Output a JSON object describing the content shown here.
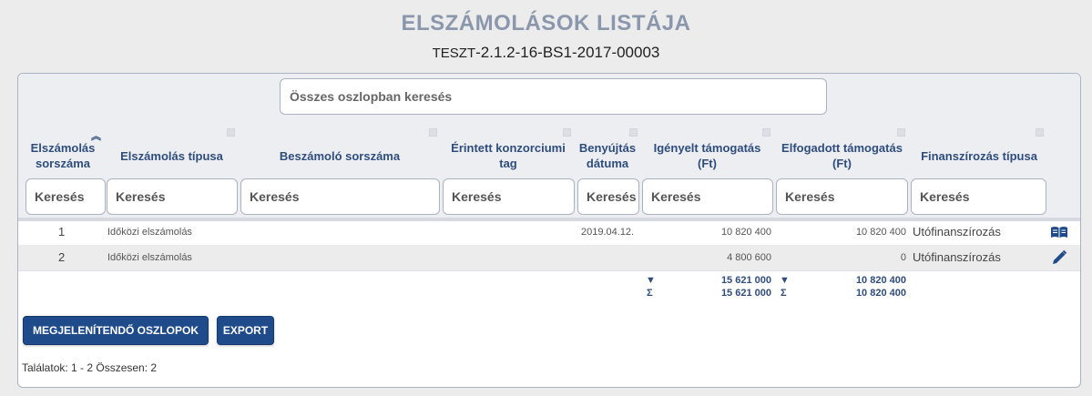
{
  "page": {
    "title": "ELSZÁMOLÁSOK LISTÁJA",
    "subtitle_prefix": "TESZT",
    "subtitle_rest": "-2.1.2-16-BS1-2017-00003"
  },
  "global_search": {
    "placeholder": "Összes oszlopban keresés"
  },
  "columns": [
    {
      "l1": "Elszámolás",
      "l2": "sorszáma"
    },
    {
      "l1": "Elszámolás típusa",
      "l2": ""
    },
    {
      "l1": "Beszámoló sorszáma",
      "l2": ""
    },
    {
      "l1": "Érintett konzorciumi",
      "l2": "tag"
    },
    {
      "l1": "Benyújtás",
      "l2": "dátuma"
    },
    {
      "l1": "Igényelt támogatás",
      "l2": "(Ft)"
    },
    {
      "l1": "Elfogadott támogatás",
      "l2": "(Ft)"
    },
    {
      "l1": "Finanszírozás típusa",
      "l2": ""
    }
  ],
  "column_search_placeholder": "Keresés",
  "rows": [
    {
      "num": "1",
      "type": "Időközi elszámolás",
      "report": "",
      "member": "",
      "date": "2019.04.12.",
      "requested": "10 820 400",
      "accepted": "10 820 400",
      "financing": "Utófinanszírozás",
      "action_icon": "book-icon"
    },
    {
      "num": "2",
      "type": "Időközi elszámolás",
      "report": "",
      "member": "",
      "date": "",
      "requested": "4 800 600",
      "accepted": "0",
      "financing": "Utófinanszírozás",
      "action_icon": "pencil-icon"
    }
  ],
  "totals": {
    "requested_filtered": "15 621 000",
    "requested_sum": "15 621 000",
    "accepted_filtered": "10 820 400",
    "accepted_sum": "10 820 400",
    "filter_symbol": "▼",
    "sum_symbol": "Σ"
  },
  "buttons": {
    "columns": "MEGJELENÍTENDŐ OSZLOPOK",
    "export": "EXPORT"
  },
  "footer": {
    "results": "Találatok: 1 - 2 Összesen: 2"
  },
  "colors": {
    "accent": "#1f4b8b",
    "header_text": "#2f4d7c",
    "title": "#8a97ac"
  }
}
